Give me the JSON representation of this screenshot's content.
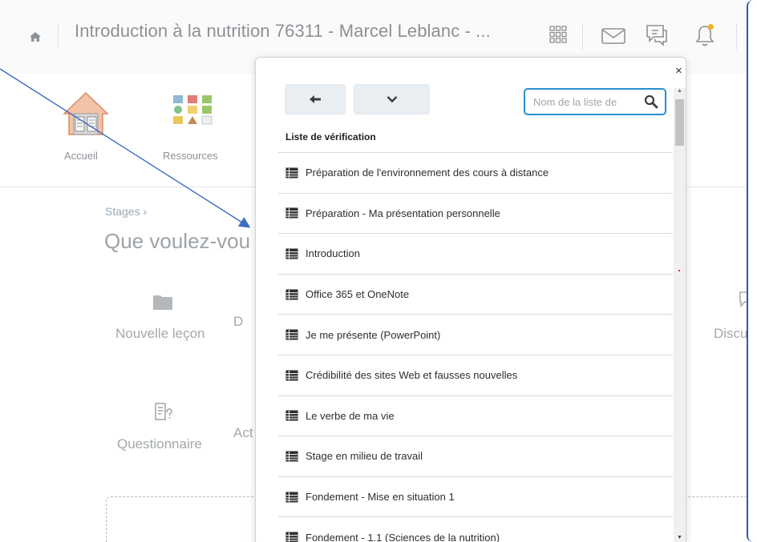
{
  "topbar": {
    "course_title": "Introduction à la nutrition 76311 - Marcel Leblanc - ...",
    "icons": [
      "home-icon",
      "grid-icon",
      "mail-icon",
      "chat-icon",
      "bell-icon"
    ],
    "notification_color": "#f3b21c"
  },
  "navband": {
    "items": [
      {
        "label": "Accueil",
        "icon": "home-house-icon"
      },
      {
        "label": "Ressources",
        "icon": "resources-grid-icon"
      }
    ]
  },
  "background": {
    "breadcrumb": "Stages ›",
    "heading": "Que voulez-vou",
    "items": [
      {
        "label": "Nouvelle leçon",
        "icon": "folder-icon"
      },
      {
        "label": "D"
      },
      {
        "label": "Discus"
      },
      {
        "label": "Questionnaire",
        "icon": "quiz-icon"
      },
      {
        "label": "Act"
      }
    ]
  },
  "popup": {
    "back_icon": "arrow-left-icon",
    "menu_icon": "chevron-down-icon",
    "search_placeholder": "Nom de la liste de",
    "close_label": "×",
    "list_header": "Liste de vérification",
    "items": [
      {
        "label": "Préparation de l'environnement des cours à distance"
      },
      {
        "label": "Préparation - Ma présentation personnelle"
      },
      {
        "label": "Introduction"
      },
      {
        "label": "Office 365 et OneNote"
      },
      {
        "label": "Je me présente (PowerPoint)"
      },
      {
        "label": "Crédibilité des sites Web et fausses nouvelles"
      },
      {
        "label": "Le verbe de ma vie"
      },
      {
        "label": "Stage en milieu de travail"
      },
      {
        "label": "Fondement - Mise en situation 1"
      },
      {
        "label": "Fondement - 1.1 (Sciences de la nutrition)"
      }
    ]
  },
  "colors": {
    "accent": "#2a8fd0",
    "annotation": "#2a5aa6"
  }
}
